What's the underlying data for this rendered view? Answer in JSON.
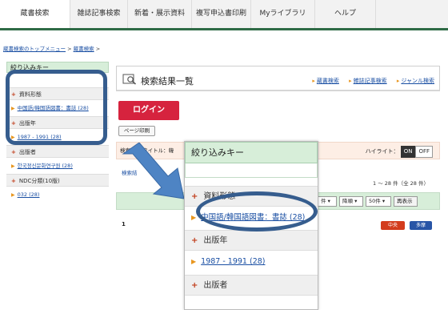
{
  "tabs": [
    {
      "label": "蔵書検索",
      "active": true
    },
    {
      "label": "雑誌記事検索",
      "active": false
    },
    {
      "label": "新着・展示資料",
      "active": false
    },
    {
      "label": "複写申込書印刷",
      "active": false
    },
    {
      "label": "Myライブラリ",
      "active": false
    },
    {
      "label": "ヘルプ",
      "active": false
    }
  ],
  "breadcrumb": {
    "home": "蔵書検索のトップメニュー",
    "sep": ">",
    "current": "蔵書検索",
    "tail": ">"
  },
  "sidebar": {
    "title": "絞り込みキー",
    "sections": [
      {
        "label": "資料形態",
        "items": [
          "中国語/韓国語図書：書誌 (28)"
        ]
      },
      {
        "label": "出版年",
        "items": [
          "1987 - 1991 (28)"
        ]
      },
      {
        "label": "出版者",
        "items": [
          "한국정신문화연구원 (28)"
        ]
      },
      {
        "label": "NDC分類(10版)",
        "items": [
          "032 (28)"
        ]
      }
    ]
  },
  "main": {
    "title": "検索結果一覧",
    "links": [
      "蔵書検索",
      "雑誌記事検索",
      "ジャンル検索"
    ],
    "login": "ログイン",
    "print": "ページ印刷",
    "condition": "検索条件 タイトル：韓",
    "condition_link": "検索結",
    "highlight": {
      "label": "ハイライト：",
      "on": "ON",
      "off": "OFF"
    },
    "count": "1 ～ 28 件（全 28 件）",
    "sort_options": [
      "件",
      "降順",
      "50件"
    ],
    "redisplay": "再表示",
    "page": "1",
    "badges": [
      "中央",
      "多摩"
    ]
  },
  "zoom_panel": {
    "title": "絞り込みキー",
    "sections": [
      {
        "label": "資料形態",
        "items": [
          "中国語/韓国語図書：書誌 (28)"
        ]
      },
      {
        "label": "出版年",
        "items": [
          "1987 - 1991 (28)"
        ]
      },
      {
        "label": "出版者",
        "items": []
      }
    ]
  },
  "colors": {
    "tab_underline": "#2f6b46",
    "sidebar_head": "#d7eed9",
    "login": "#d6233e",
    "annotation": "#365d8e",
    "link": "#1a4fa3"
  }
}
